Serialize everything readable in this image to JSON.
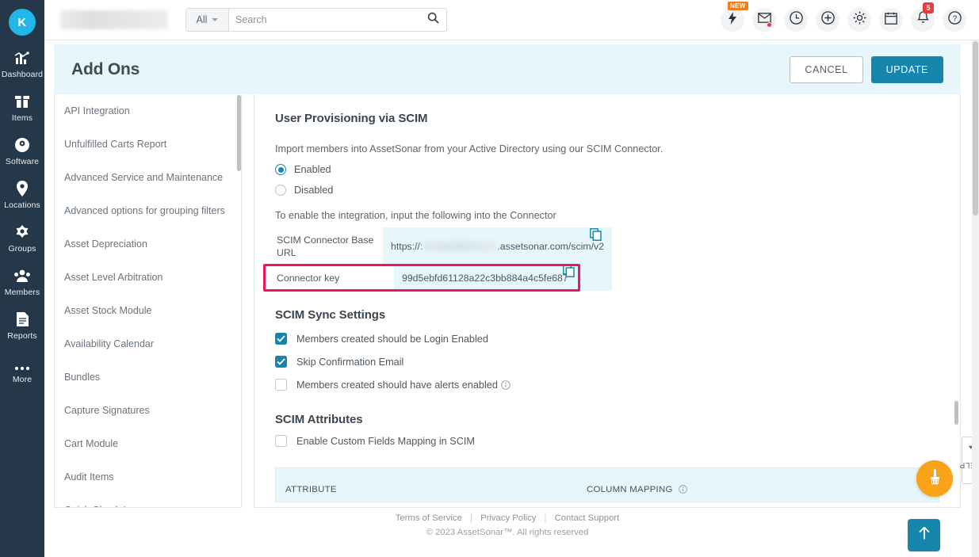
{
  "brand": {
    "avatar_initial": "K",
    "accent": "#1686ad",
    "sidebar_bg": "#25384a",
    "highlight": "#ed1661"
  },
  "topbar": {
    "search_category": "All",
    "search_placeholder": "Search",
    "search_value": "",
    "icons": [
      {
        "name": "lightning-icon",
        "badge": "NEW"
      },
      {
        "name": "mail-icon",
        "badge": ""
      },
      {
        "name": "clock-icon",
        "badge": ""
      },
      {
        "name": "plus-circle-icon",
        "badge": ""
      },
      {
        "name": "gear-icon",
        "badge": ""
      },
      {
        "name": "calendar-icon",
        "badge": ""
      },
      {
        "name": "bell-icon",
        "badge": "5"
      },
      {
        "name": "help-icon",
        "badge": ""
      }
    ],
    "notification_count": "5",
    "new_badge": "NEW"
  },
  "sidebar": {
    "items": [
      {
        "label": "Dashboard",
        "icon": "chart-bars-icon"
      },
      {
        "label": "Items",
        "icon": "box-icon"
      },
      {
        "label": "Software",
        "icon": "disc-icon"
      },
      {
        "label": "Locations",
        "icon": "map-pin-icon"
      },
      {
        "label": "Groups",
        "icon": "flower-icon"
      },
      {
        "label": "Members",
        "icon": "people-icon"
      },
      {
        "label": "Reports",
        "icon": "report-icon"
      },
      {
        "label": "More",
        "icon": "ellipsis-icon"
      }
    ]
  },
  "page": {
    "title": "Add Ons",
    "cancel_label": "CANCEL",
    "update_label": "UPDATE"
  },
  "addons_list": [
    "API Integration",
    "Unfulfilled Carts Report",
    "Advanced Service and Maintenance",
    "Advanced options for grouping filters",
    "Asset Depreciation",
    "Asset Level Arbitration",
    "Asset Stock Module",
    "Availability Calendar",
    "Bundles",
    "Capture Signatures",
    "Cart Module",
    "Audit Items",
    "Quick Check In"
  ],
  "scim": {
    "heading": "User Provisioning via SCIM",
    "description": "Import members into AssetSonar from your Active Directory using our SCIM Connector.",
    "radio_enabled": "Enabled",
    "radio_disabled": "Disabled",
    "selected_option": "Enabled",
    "instruction": "To enable the integration, input the following into the Connector",
    "base_url_label": "SCIM Connector Base URL",
    "base_url_prefix": "https://:",
    "base_url_suffix": ".assetsonar.com/scim/v2",
    "connector_key_label": "Connector key",
    "connector_key_value": "99d5ebfd61128a22c3bb884a4c5fe687"
  },
  "sync_settings": {
    "heading": "SCIM Sync Settings",
    "options": [
      {
        "label": "Members created should be Login Enabled",
        "checked": true,
        "info": false
      },
      {
        "label": "Skip Confirmation Email",
        "checked": true,
        "info": false
      },
      {
        "label": "Members created should have alerts enabled",
        "checked": false,
        "info": true
      }
    ]
  },
  "attributes": {
    "heading": "SCIM Attributes",
    "enable_mapping_label": "Enable Custom Fields Mapping in SCIM",
    "enable_mapping_checked": false,
    "col_attribute": "ATTRIBUTE",
    "col_mapping": "COLUMN MAPPING"
  },
  "footer": {
    "terms": "Terms of Service",
    "privacy": "Privacy Policy",
    "support": "Contact Support",
    "copyright": "© 2023 AssetSonar™. All rights reserved"
  },
  "floating": {
    "help_label": "HELP",
    "fab_icon": "paintbrush-icon",
    "scroll_top_icon": "arrow-up-icon"
  }
}
